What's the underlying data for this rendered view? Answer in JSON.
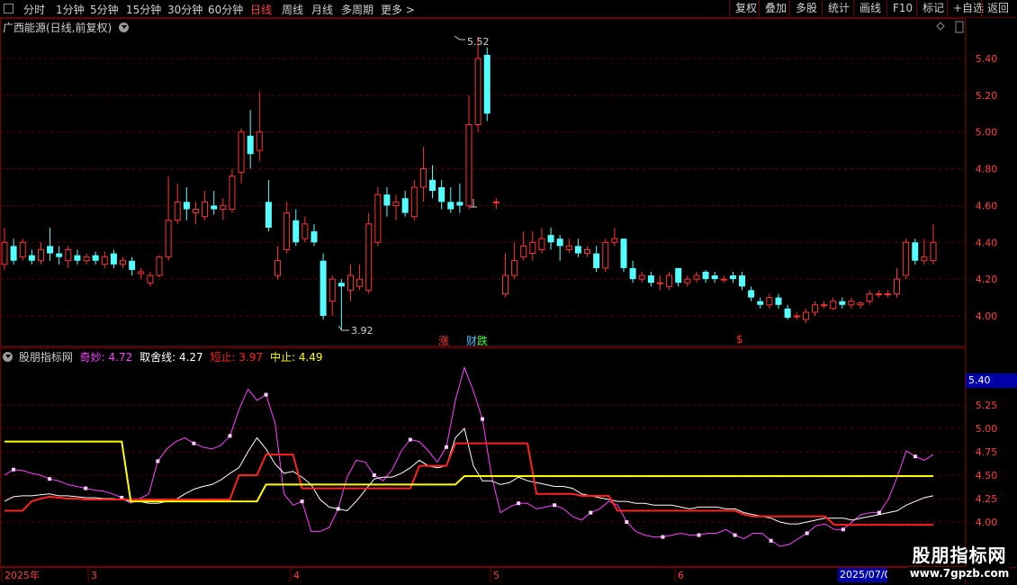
{
  "toolbar": {
    "left_items": [
      "分时",
      "1分钟",
      "5分钟",
      "15分钟",
      "30分钟",
      "60分钟",
      "日线",
      "周线",
      "月线",
      "多周期",
      "更多 >"
    ],
    "right_items": [
      "复权",
      "叠加",
      "多股",
      "统计",
      "画线",
      "F10",
      "标记",
      "+自选",
      "返回"
    ]
  },
  "main_chart": {
    "title": "广西能源(日线,前复权)",
    "y_ticks": [
      "5.40",
      "5.20",
      "5.00",
      "4.80",
      "4.60",
      "4.40",
      "4.20",
      "4.00"
    ],
    "high_label": "5.52",
    "low_label": "3.92",
    "markers": [
      {
        "text": "涨",
        "color": "#ff3030"
      },
      {
        "text": "财",
        "color": "#40c0ff"
      },
      {
        "text": "跌",
        "color": "#40ff40"
      },
      {
        "text": "$",
        "color": "#ff3030"
      }
    ],
    "colors": {
      "up": "#ff3333",
      "down": "#54ffff"
    }
  },
  "indicator": {
    "name": "股朋指标网",
    "qimiao_label": "奇妙:",
    "qimiao_value": "4.72",
    "qushe_label": "取舍线:",
    "qushe_value": "4.27",
    "duanzhi_label": "短止:",
    "duanzhi_value": "3.97",
    "zhongzhi_label": "中止:",
    "zhongzhi_value": "4.49",
    "y_ticks": [
      "5.25",
      "5.00",
      "4.75",
      "4.50",
      "4.25",
      "4.00"
    ],
    "cursor_value": "5.40",
    "colors": {
      "qimiao": "#ff40ff",
      "qushe": "#ffffff",
      "duanzhi": "#ff2020",
      "zhongzhi": "#ffff00"
    }
  },
  "date_axis": {
    "labels": [
      "2025年",
      "3",
      "4",
      "5",
      "6"
    ],
    "cursor_date": "2025/07/0"
  },
  "watermark": {
    "cn": "股朋指标网",
    "url": "www.7gpzb.com"
  },
  "chart_data": [
    {
      "type": "candlestick",
      "title": "广西能源(日线,前复权)",
      "ylim": [
        3.85,
        5.55
      ],
      "candles": [
        [
          4.28,
          4.4,
          4.25,
          4.48
        ],
        [
          4.38,
          4.3,
          4.28,
          4.42
        ],
        [
          4.32,
          4.4,
          4.3,
          4.42
        ],
        [
          4.33,
          4.3,
          4.28,
          4.36
        ],
        [
          4.3,
          4.36,
          4.28,
          4.4
        ],
        [
          4.38,
          4.34,
          4.3,
          4.48
        ],
        [
          4.34,
          4.32,
          4.28,
          4.38
        ],
        [
          4.3,
          4.36,
          4.26,
          4.38
        ],
        [
          4.33,
          4.3,
          4.28,
          4.36
        ],
        [
          4.3,
          4.32,
          4.28,
          4.34
        ],
        [
          4.33,
          4.3,
          4.28,
          4.35
        ],
        [
          4.28,
          4.32,
          4.26,
          4.35
        ],
        [
          4.34,
          4.28,
          4.26,
          4.36
        ],
        [
          4.28,
          4.3,
          4.26,
          4.32
        ],
        [
          4.3,
          4.25,
          4.22,
          4.32
        ],
        [
          4.23,
          4.24,
          4.2,
          4.26
        ],
        [
          4.18,
          4.22,
          4.16,
          4.24
        ],
        [
          4.22,
          4.32,
          4.21,
          4.33
        ],
        [
          4.32,
          4.52,
          4.3,
          4.76
        ],
        [
          4.52,
          4.62,
          4.5,
          4.72
        ],
        [
          4.62,
          4.58,
          4.52,
          4.7
        ],
        [
          4.56,
          4.58,
          4.5,
          4.62
        ],
        [
          4.54,
          4.62,
          4.52,
          4.68
        ],
        [
          4.6,
          4.58,
          4.55,
          4.68
        ],
        [
          4.58,
          4.6,
          4.52,
          4.64
        ],
        [
          4.58,
          4.76,
          4.56,
          4.8
        ],
        [
          4.78,
          5.0,
          4.72,
          5.02
        ],
        [
          4.98,
          4.88,
          4.8,
          5.12
        ],
        [
          4.9,
          5.0,
          4.84,
          5.22
        ],
        [
          4.62,
          4.48,
          4.46,
          4.74
        ],
        [
          4.22,
          4.3,
          4.2,
          4.38
        ],
        [
          4.36,
          4.56,
          4.34,
          4.62
        ],
        [
          4.52,
          4.4,
          4.38,
          4.58
        ],
        [
          4.42,
          4.5,
          4.4,
          4.54
        ],
        [
          4.46,
          4.4,
          4.38,
          4.5
        ],
        [
          4.3,
          4.0,
          3.98,
          4.34
        ],
        [
          4.08,
          4.2,
          4.0,
          4.22
        ],
        [
          4.18,
          4.16,
          3.92,
          4.2
        ],
        [
          4.14,
          4.22,
          4.08,
          4.28
        ],
        [
          4.16,
          4.2,
          4.14,
          4.28
        ],
        [
          4.14,
          4.5,
          4.12,
          4.56
        ],
        [
          4.4,
          4.66,
          4.38,
          4.7
        ],
        [
          4.66,
          4.6,
          4.54,
          4.7
        ],
        [
          4.6,
          4.62,
          4.52,
          4.66
        ],
        [
          4.64,
          4.56,
          4.54,
          4.68
        ],
        [
          4.54,
          4.7,
          4.52,
          4.74
        ],
        [
          4.7,
          4.8,
          4.62,
          4.92
        ],
        [
          4.74,
          4.68,
          4.64,
          4.82
        ],
        [
          4.7,
          4.62,
          4.58,
          4.74
        ],
        [
          4.62,
          4.58,
          4.56,
          4.7
        ],
        [
          4.62,
          4.6,
          4.56,
          4.72
        ],
        [
          4.6,
          5.04,
          4.58,
          5.2
        ],
        [
          5.04,
          5.4,
          5.0,
          5.52
        ],
        [
          5.42,
          5.1,
          5.06,
          5.46
        ],
        [
          4.62,
          4.62,
          4.58,
          4.64
        ],
        [
          4.12,
          4.22,
          4.1,
          4.34
        ],
        [
          4.22,
          4.3,
          4.2,
          4.4
        ],
        [
          4.32,
          4.38,
          4.3,
          4.46
        ],
        [
          4.34,
          4.4,
          4.3,
          4.46
        ],
        [
          4.36,
          4.42,
          4.34,
          4.48
        ],
        [
          4.44,
          4.4,
          4.36,
          4.48
        ],
        [
          4.42,
          4.38,
          4.3,
          4.44
        ],
        [
          4.36,
          4.38,
          4.34,
          4.42
        ],
        [
          4.38,
          4.34,
          4.32,
          4.42
        ],
        [
          4.34,
          4.36,
          4.32,
          4.38
        ],
        [
          4.34,
          4.26,
          4.24,
          4.38
        ],
        [
          4.26,
          4.4,
          4.24,
          4.42
        ],
        [
          4.4,
          4.42,
          4.38,
          4.48
        ],
        [
          4.42,
          4.26,
          4.24,
          4.42
        ],
        [
          4.26,
          4.2,
          4.18,
          4.3
        ],
        [
          4.2,
          4.22,
          4.18,
          4.24
        ],
        [
          4.22,
          4.18,
          4.16,
          4.24
        ],
        [
          4.18,
          4.18,
          4.14,
          4.22
        ],
        [
          4.16,
          4.22,
          4.14,
          4.24
        ],
        [
          4.26,
          4.18,
          4.16,
          4.26
        ],
        [
          4.18,
          4.2,
          4.16,
          4.22
        ],
        [
          4.2,
          4.22,
          4.18,
          4.24
        ],
        [
          4.24,
          4.2,
          4.18,
          4.25
        ],
        [
          4.22,
          4.2,
          4.18,
          4.24
        ],
        [
          4.2,
          4.2,
          4.18,
          4.22
        ],
        [
          4.22,
          4.2,
          4.18,
          4.24
        ],
        [
          4.22,
          4.16,
          4.14,
          4.24
        ],
        [
          4.14,
          4.1,
          4.08,
          4.16
        ],
        [
          4.08,
          4.06,
          4.04,
          4.1
        ],
        [
          4.06,
          4.1,
          4.04,
          4.12
        ],
        [
          4.1,
          4.06,
          4.04,
          4.12
        ],
        [
          4.04,
          3.99,
          3.98,
          4.06
        ],
        [
          4.0,
          4.0,
          3.98,
          4.02
        ],
        [
          3.98,
          4.02,
          3.96,
          4.04
        ],
        [
          4.02,
          4.06,
          4.0,
          4.08
        ],
        [
          4.06,
          4.06,
          4.04,
          4.08
        ],
        [
          4.04,
          4.08,
          4.03,
          4.1
        ],
        [
          4.08,
          4.06,
          4.04,
          4.1
        ],
        [
          4.06,
          4.08,
          4.04,
          4.1
        ],
        [
          4.06,
          4.07,
          4.04,
          4.08
        ],
        [
          4.08,
          4.12,
          4.06,
          4.14
        ],
        [
          4.12,
          4.12,
          4.1,
          4.14
        ],
        [
          4.12,
          4.12,
          4.1,
          4.14
        ],
        [
          4.12,
          4.2,
          4.1,
          4.26
        ],
        [
          4.22,
          4.4,
          4.2,
          4.42
        ],
        [
          4.4,
          4.3,
          4.28,
          4.42
        ],
        [
          4.3,
          4.32,
          4.28,
          4.42
        ],
        [
          4.3,
          4.4,
          4.28,
          4.5
        ]
      ]
    },
    {
      "type": "line",
      "title": "股朋指标网",
      "ylim": [
        3.82,
        5.65
      ],
      "series": [
        {
          "name": "奇妙",
          "color": "#ff40ff",
          "values": [
            4.5,
            4.56,
            4.55,
            4.52,
            4.5,
            4.46,
            4.44,
            4.4,
            4.38,
            4.36,
            4.34,
            4.33,
            4.3,
            4.26,
            4.2,
            4.25,
            4.3,
            4.65,
            4.78,
            4.86,
            4.9,
            4.84,
            4.8,
            4.78,
            4.82,
            4.92,
            5.2,
            5.42,
            5.3,
            5.36,
            5.06,
            4.3,
            4.18,
            4.22,
            3.9,
            3.9,
            3.94,
            4.14,
            4.48,
            4.66,
            4.64,
            4.5,
            4.44,
            4.56,
            4.76,
            4.88,
            4.86,
            4.76,
            4.64,
            4.8,
            5.3,
            5.65,
            5.4,
            5.1,
            4.5,
            4.1,
            4.16,
            4.2,
            4.2,
            4.14,
            4.16,
            4.18,
            4.14,
            4.06,
            4.02,
            4.1,
            4.14,
            4.22,
            4.18,
            4.0,
            3.9,
            3.86,
            3.84,
            3.84,
            3.86,
            3.88,
            3.86,
            3.86,
            3.88,
            3.88,
            3.92,
            3.86,
            3.82,
            3.88,
            3.88,
            3.8,
            3.74,
            3.76,
            3.82,
            3.88,
            3.96,
            3.98,
            3.92,
            3.92,
            4.0,
            4.08,
            4.1,
            4.1,
            4.24,
            4.48,
            4.76,
            4.7,
            4.66,
            4.72
          ]
        },
        {
          "name": "取舍线",
          "color": "#ffffff",
          "values": [
            4.22,
            4.27,
            4.28,
            4.28,
            4.29,
            4.3,
            4.28,
            4.28,
            4.27,
            4.26,
            4.26,
            4.25,
            4.25,
            4.24,
            4.22,
            4.22,
            4.2,
            4.2,
            4.22,
            4.24,
            4.3,
            4.35,
            4.38,
            4.4,
            4.45,
            4.52,
            4.58,
            4.75,
            4.9,
            4.78,
            4.62,
            4.52,
            4.54,
            4.48,
            4.4,
            4.24,
            4.16,
            4.14,
            4.12,
            4.22,
            4.34,
            4.46,
            4.48,
            4.48,
            4.52,
            4.58,
            4.66,
            4.6,
            4.58,
            4.6,
            4.9,
            5.0,
            4.6,
            4.44,
            4.44,
            4.4,
            4.42,
            4.48,
            4.44,
            4.42,
            4.4,
            4.38,
            4.38,
            4.36,
            4.3,
            4.28,
            4.26,
            4.24,
            4.22,
            4.22,
            4.2,
            4.2,
            4.18,
            4.18,
            4.18,
            4.16,
            4.14,
            4.16,
            4.16,
            4.16,
            4.14,
            4.14,
            4.1,
            4.08,
            4.06,
            4.04,
            4.0,
            3.98,
            3.98,
            4.0,
            4.02,
            4.04,
            4.04,
            4.04,
            4.02,
            4.04,
            4.06,
            4.08,
            4.1,
            4.12,
            4.18,
            4.22,
            4.26,
            4.28
          ]
        },
        {
          "name": "短止",
          "color": "#ff2020",
          "values": [
            4.12,
            4.12,
            4.12,
            4.22,
            4.25,
            4.27,
            4.26,
            4.25,
            4.25,
            4.24,
            4.24,
            4.24,
            4.24,
            4.24,
            4.24,
            4.24,
            4.24,
            4.24,
            4.24,
            4.24,
            4.24,
            4.24,
            4.24,
            4.24,
            4.24,
            4.24,
            4.5,
            4.5,
            4.5,
            4.72,
            4.72,
            4.72,
            4.72,
            4.36,
            4.36,
            4.36,
            4.36,
            4.36,
            4.36,
            4.36,
            4.36,
            4.36,
            4.36,
            4.36,
            4.36,
            4.36,
            4.6,
            4.6,
            4.6,
            4.6,
            4.84,
            4.84,
            4.84,
            4.84,
            4.84,
            4.84,
            4.84,
            4.84,
            4.84,
            4.3,
            4.3,
            4.3,
            4.3,
            4.3,
            4.28,
            4.28,
            4.28,
            4.28,
            4.12,
            4.12,
            4.12,
            4.12,
            4.12,
            4.12,
            4.12,
            4.12,
            4.12,
            4.12,
            4.12,
            4.12,
            4.12,
            4.12,
            4.08,
            4.06,
            4.06,
            4.06,
            4.06,
            4.06,
            4.06,
            4.06,
            4.06,
            4.06,
            3.97,
            3.97,
            3.97,
            3.97,
            3.97,
            3.97,
            3.97,
            3.97,
            3.97,
            3.97,
            3.97,
            3.97
          ]
        },
        {
          "name": "中止",
          "color": "#ffff00",
          "values": [
            4.86,
            4.86,
            4.86,
            4.86,
            4.86,
            4.86,
            4.86,
            4.86,
            4.86,
            4.86,
            4.86,
            4.86,
            4.86,
            4.86,
            4.22,
            4.22,
            4.22,
            4.22,
            4.22,
            4.22,
            4.22,
            4.22,
            4.22,
            4.22,
            4.22,
            4.22,
            4.22,
            4.22,
            4.22,
            4.4,
            4.4,
            4.4,
            4.4,
            4.4,
            4.4,
            4.4,
            4.4,
            4.4,
            4.4,
            4.4,
            4.4,
            4.4,
            4.4,
            4.4,
            4.4,
            4.4,
            4.4,
            4.4,
            4.4,
            4.4,
            4.4,
            4.49,
            4.49,
            4.49,
            4.49,
            4.49,
            4.49,
            4.49,
            4.49,
            4.49,
            4.49,
            4.49,
            4.49,
            4.49,
            4.49,
            4.49,
            4.49,
            4.49,
            4.49,
            4.49,
            4.49,
            4.49,
            4.49,
            4.49,
            4.49,
            4.49,
            4.49,
            4.49,
            4.49,
            4.49,
            4.49,
            4.49,
            4.49,
            4.49,
            4.49,
            4.49,
            4.49,
            4.49,
            4.49,
            4.49,
            4.49,
            4.49,
            4.49,
            4.49,
            4.49,
            4.49,
            4.49,
            4.49,
            4.49,
            4.49,
            4.49,
            4.49,
            4.49,
            4.49
          ]
        }
      ]
    }
  ]
}
